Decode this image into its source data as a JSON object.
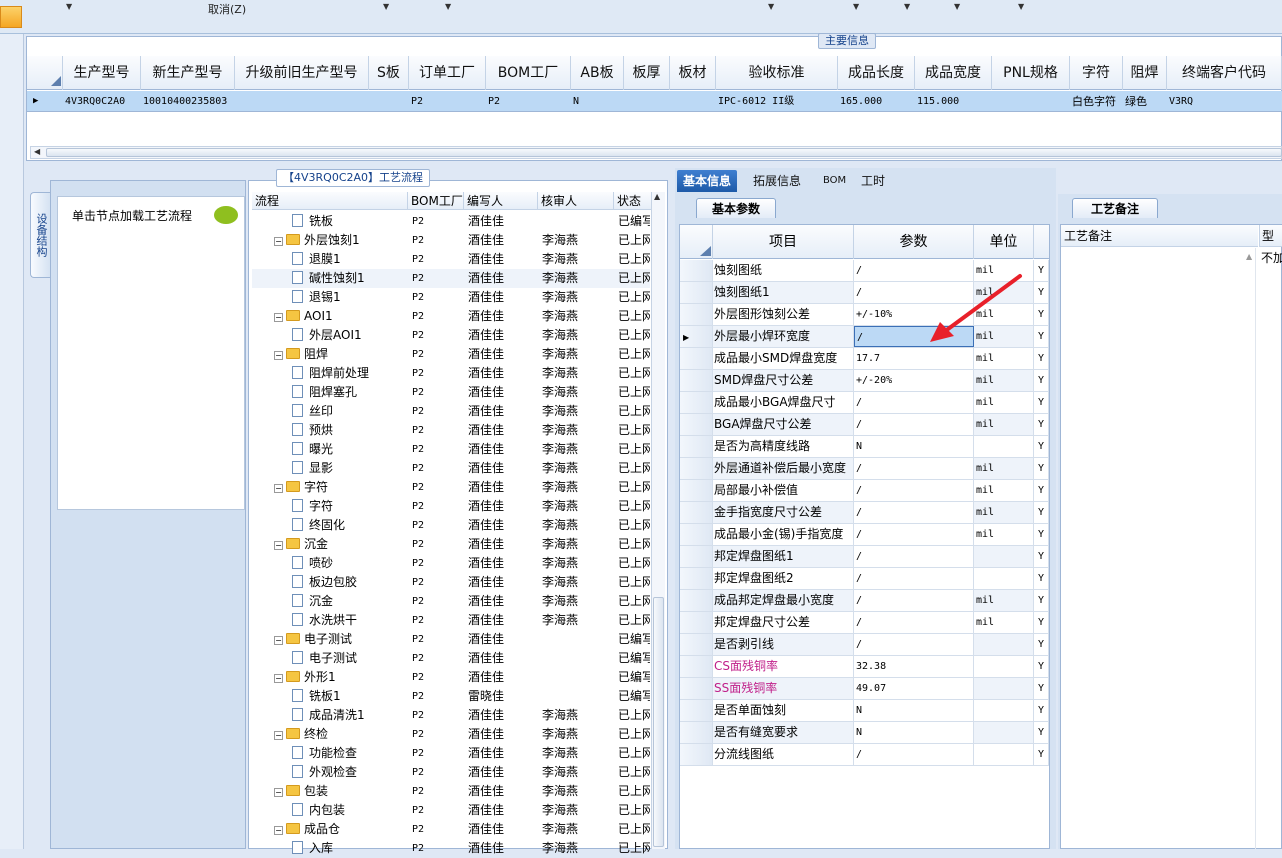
{
  "toolbar": {
    "cancel_label": "取消(Z)"
  },
  "main_info": {
    "title": "主要信息",
    "columns": [
      "生产型号",
      "新生产型号",
      "升级前旧生产型号",
      "S板",
      "订单工厂",
      "BOM工厂",
      "AB板",
      "板厚",
      "板材",
      "验收标准",
      "成品长度",
      "成品宽度",
      "PNL规格",
      "字符",
      "阻焊",
      "终端客户代码"
    ],
    "row": {
      "prod_model": "4V3RQ0C2A0",
      "new_prod_model": "10010400235803",
      "old_model": "",
      "s_board": "",
      "order_factory": "P2",
      "bom_factory": "P2",
      "ab_board": "N",
      "thickness": "",
      "material": "",
      "standard": "IPC-6012 II级",
      "length": "165.000",
      "width": "115.000",
      "pnl": "",
      "char": "白色字符",
      "solder_mask": "绿色",
      "customer_code": "V3RQ"
    }
  },
  "left_nav": {
    "side_tab": "设备结构",
    "hint": "单击节点加载工艺流程"
  },
  "flow": {
    "title": "【4V3RQ0C2A0】工艺流程",
    "columns": [
      "流程",
      "BOM工厂",
      "编写人",
      "核审人",
      "状态"
    ],
    "rows": [
      {
        "level": 2,
        "type": "doc",
        "name": "铣板",
        "bom": "P2",
        "author": "酒佳佳",
        "reviewer": "",
        "status": "已编写"
      },
      {
        "level": 1,
        "type": "folder",
        "name": "外层蚀刻1",
        "bom": "P2",
        "author": "酒佳佳",
        "reviewer": "李海燕",
        "status": "已上网"
      },
      {
        "level": 2,
        "type": "doc",
        "name": "退膜1",
        "bom": "P2",
        "author": "酒佳佳",
        "reviewer": "李海燕",
        "status": "已上网"
      },
      {
        "level": 2,
        "type": "doc",
        "name": "碱性蚀刻1",
        "bom": "P2",
        "author": "酒佳佳",
        "reviewer": "李海燕",
        "status": "已上网"
      },
      {
        "level": 2,
        "type": "doc",
        "name": "退锡1",
        "bom": "P2",
        "author": "酒佳佳",
        "reviewer": "李海燕",
        "status": "已上网"
      },
      {
        "level": 1,
        "type": "folder",
        "name": "AOI1",
        "bom": "P2",
        "author": "酒佳佳",
        "reviewer": "李海燕",
        "status": "已上网"
      },
      {
        "level": 2,
        "type": "doc",
        "name": "外层AOI1",
        "bom": "P2",
        "author": "酒佳佳",
        "reviewer": "李海燕",
        "status": "已上网"
      },
      {
        "level": 1,
        "type": "folder",
        "name": "阻焊",
        "bom": "P2",
        "author": "酒佳佳",
        "reviewer": "李海燕",
        "status": "已上网"
      },
      {
        "level": 2,
        "type": "doc",
        "name": "阻焊前处理",
        "bom": "P2",
        "author": "酒佳佳",
        "reviewer": "李海燕",
        "status": "已上网"
      },
      {
        "level": 2,
        "type": "doc",
        "name": "阻焊塞孔",
        "bom": "P2",
        "author": "酒佳佳",
        "reviewer": "李海燕",
        "status": "已上网"
      },
      {
        "level": 2,
        "type": "doc",
        "name": "丝印",
        "bom": "P2",
        "author": "酒佳佳",
        "reviewer": "李海燕",
        "status": "已上网"
      },
      {
        "level": 2,
        "type": "doc",
        "name": "预烘",
        "bom": "P2",
        "author": "酒佳佳",
        "reviewer": "李海燕",
        "status": "已上网"
      },
      {
        "level": 2,
        "type": "doc",
        "name": "曝光",
        "bom": "P2",
        "author": "酒佳佳",
        "reviewer": "李海燕",
        "status": "已上网"
      },
      {
        "level": 2,
        "type": "doc",
        "name": "显影",
        "bom": "P2",
        "author": "酒佳佳",
        "reviewer": "李海燕",
        "status": "已上网"
      },
      {
        "level": 1,
        "type": "folder",
        "name": "字符",
        "bom": "P2",
        "author": "酒佳佳",
        "reviewer": "李海燕",
        "status": "已上网"
      },
      {
        "level": 2,
        "type": "doc",
        "name": "字符",
        "bom": "P2",
        "author": "酒佳佳",
        "reviewer": "李海燕",
        "status": "已上网"
      },
      {
        "level": 2,
        "type": "doc",
        "name": "终固化",
        "bom": "P2",
        "author": "酒佳佳",
        "reviewer": "李海燕",
        "status": "已上网"
      },
      {
        "level": 1,
        "type": "folder",
        "name": "沉金",
        "bom": "P2",
        "author": "酒佳佳",
        "reviewer": "李海燕",
        "status": "已上网"
      },
      {
        "level": 2,
        "type": "doc",
        "name": "喷砂",
        "bom": "P2",
        "author": "酒佳佳",
        "reviewer": "李海燕",
        "status": "已上网"
      },
      {
        "level": 2,
        "type": "doc",
        "name": "板边包胶",
        "bom": "P2",
        "author": "酒佳佳",
        "reviewer": "李海燕",
        "status": "已上网"
      },
      {
        "level": 2,
        "type": "doc",
        "name": "沉金",
        "bom": "P2",
        "author": "酒佳佳",
        "reviewer": "李海燕",
        "status": "已上网"
      },
      {
        "level": 2,
        "type": "doc",
        "name": "水洗烘干",
        "bom": "P2",
        "author": "酒佳佳",
        "reviewer": "李海燕",
        "status": "已上网"
      },
      {
        "level": 1,
        "type": "folder",
        "name": "电子测试",
        "bom": "P2",
        "author": "酒佳佳",
        "reviewer": "",
        "status": "已编写"
      },
      {
        "level": 2,
        "type": "doc",
        "name": "电子测试",
        "bom": "P2",
        "author": "酒佳佳",
        "reviewer": "",
        "status": "已编写"
      },
      {
        "level": 1,
        "type": "folder",
        "name": "外形1",
        "bom": "P2",
        "author": "酒佳佳",
        "reviewer": "",
        "status": "已编写"
      },
      {
        "level": 2,
        "type": "doc",
        "name": "铣板1",
        "bom": "P2",
        "author": "雷晓佳",
        "reviewer": "",
        "status": "已编写"
      },
      {
        "level": 2,
        "type": "doc",
        "name": "成品清洗1",
        "bom": "P2",
        "author": "酒佳佳",
        "reviewer": "李海燕",
        "status": "已上网"
      },
      {
        "level": 1,
        "type": "folder",
        "name": "终检",
        "bom": "P2",
        "author": "酒佳佳",
        "reviewer": "李海燕",
        "status": "已上网"
      },
      {
        "level": 2,
        "type": "doc",
        "name": "功能检查",
        "bom": "P2",
        "author": "酒佳佳",
        "reviewer": "李海燕",
        "status": "已上网"
      },
      {
        "level": 2,
        "type": "doc",
        "name": "外观检查",
        "bom": "P2",
        "author": "酒佳佳",
        "reviewer": "李海燕",
        "status": "已上网"
      },
      {
        "level": 1,
        "type": "folder",
        "name": "包装",
        "bom": "P2",
        "author": "酒佳佳",
        "reviewer": "李海燕",
        "status": "已上网"
      },
      {
        "level": 2,
        "type": "doc",
        "name": "内包装",
        "bom": "P2",
        "author": "酒佳佳",
        "reviewer": "李海燕",
        "status": "已上网"
      },
      {
        "level": 1,
        "type": "folder",
        "name": "成品仓",
        "bom": "P2",
        "author": "酒佳佳",
        "reviewer": "李海燕",
        "status": "已上网"
      },
      {
        "level": 2,
        "type": "doc",
        "name": "入库",
        "bom": "P2",
        "author": "酒佳佳",
        "reviewer": "李海燕",
        "status": "已上网"
      }
    ]
  },
  "right_tabs": [
    "基本信息",
    "拓展信息",
    "BOM",
    "工时"
  ],
  "basic_params": {
    "subtab": "基本参数",
    "columns": [
      "项目",
      "参数",
      "单位"
    ],
    "rows": [
      {
        "item": "蚀刻图纸",
        "param": "/",
        "unit": "mil",
        "flag": "Y"
      },
      {
        "item": "蚀刻图纸1",
        "param": "/",
        "unit": "mil",
        "flag": "Y"
      },
      {
        "item": "外层图形蚀刻公差",
        "param": "+/-10%",
        "unit": "mil",
        "flag": "Y"
      },
      {
        "item": "外层最小焊环宽度",
        "param": "/",
        "unit": "mil",
        "flag": "Y"
      },
      {
        "item": "成品最小SMD焊盘宽度",
        "param": "17.7",
        "unit": "mil",
        "flag": "Y"
      },
      {
        "item": "SMD焊盘尺寸公差",
        "param": "+/-20%",
        "unit": "mil",
        "flag": "Y"
      },
      {
        "item": "成品最小BGA焊盘尺寸",
        "param": "/",
        "unit": "mil",
        "flag": "Y"
      },
      {
        "item": "BGA焊盘尺寸公差",
        "param": "/",
        "unit": "mil",
        "flag": "Y"
      },
      {
        "item": "是否为高精度线路",
        "param": "N",
        "unit": "",
        "flag": "Y"
      },
      {
        "item": "外层通道补偿后最小宽度",
        "param": "/",
        "unit": "mil",
        "flag": "Y"
      },
      {
        "item": "局部最小补偿值",
        "param": "/",
        "unit": "mil",
        "flag": "Y"
      },
      {
        "item": "金手指宽度尺寸公差",
        "param": "/",
        "unit": "mil",
        "flag": "Y"
      },
      {
        "item": "成品最小金(锡)手指宽度",
        "param": "/",
        "unit": "mil",
        "flag": "Y"
      },
      {
        "item": "邦定焊盘图纸1",
        "param": "/",
        "unit": "",
        "flag": "Y"
      },
      {
        "item": "邦定焊盘图纸2",
        "param": "/",
        "unit": "",
        "flag": "Y"
      },
      {
        "item": "成品邦定焊盘最小宽度",
        "param": "/",
        "unit": "mil",
        "flag": "Y"
      },
      {
        "item": "邦定焊盘尺寸公差",
        "param": "/",
        "unit": "mil",
        "flag": "Y"
      },
      {
        "item": "是否剥引线",
        "param": "/",
        "unit": "",
        "flag": "Y"
      },
      {
        "item": "CS面残铜率",
        "param": "32.38",
        "unit": "",
        "flag": "Y",
        "highlight": true
      },
      {
        "item": "SS面残铜率",
        "param": "49.07",
        "unit": "",
        "flag": "Y",
        "highlight": true
      },
      {
        "item": "是否单面蚀刻",
        "param": "N",
        "unit": "",
        "flag": "Y"
      },
      {
        "item": "是否有缝宽要求",
        "param": "N",
        "unit": "",
        "flag": "Y"
      },
      {
        "item": "分流线图纸",
        "param": "/",
        "unit": "",
        "flag": "Y"
      }
    ],
    "highlight_color": "#c0208a",
    "arrow_color": "#e8202a"
  },
  "craft_notes": {
    "tab": "工艺备注",
    "header": "工艺备注",
    "type_header": "型号",
    "type_value": "不加"
  }
}
